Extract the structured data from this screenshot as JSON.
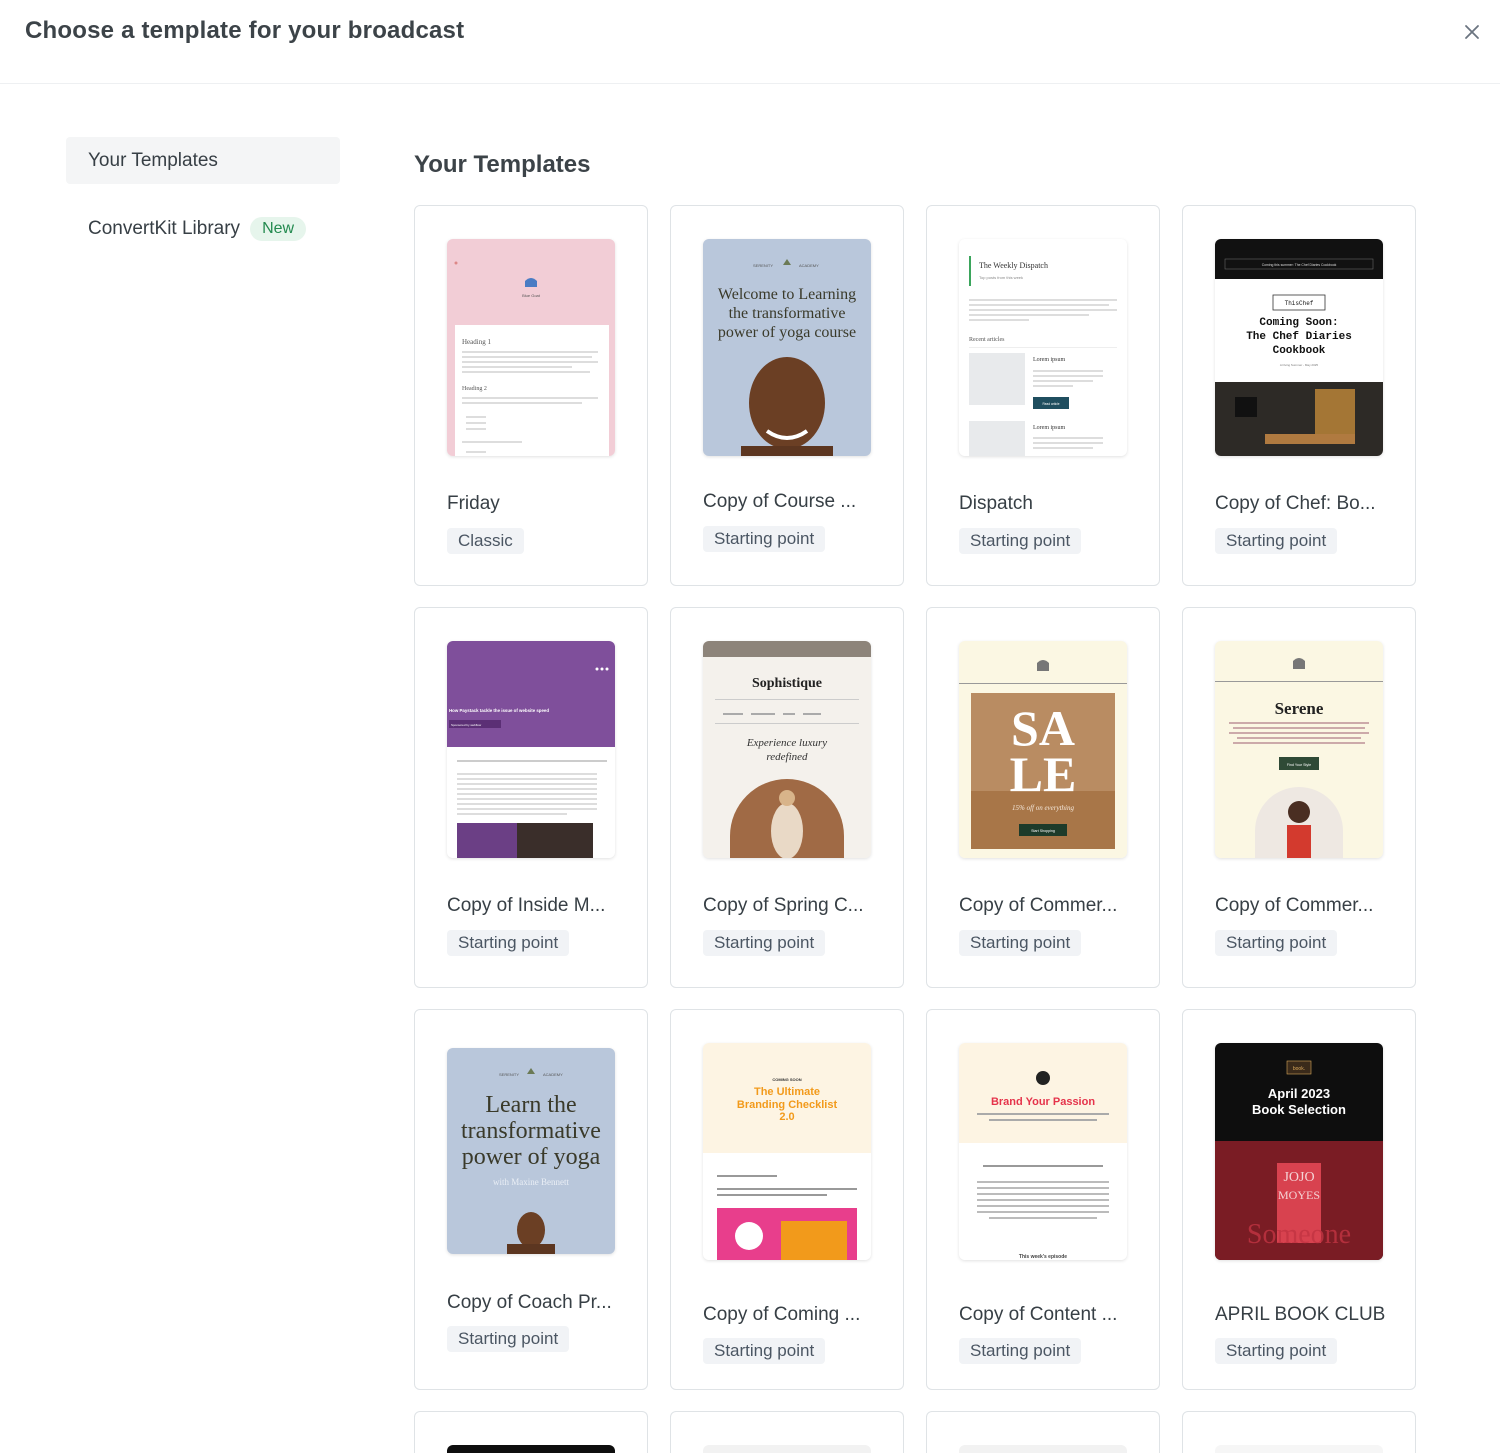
{
  "modal": {
    "title": "Choose a template for your broadcast",
    "close_icon": "close-icon"
  },
  "sidebar": {
    "items": [
      {
        "label": "Your Templates",
        "active": true
      },
      {
        "label": "ConvertKit Library",
        "badge": "New"
      }
    ]
  },
  "main": {
    "section_title": "Your Templates",
    "templates": [
      {
        "name": "Friday",
        "tag": "Classic"
      },
      {
        "name": "Copy of Course ...",
        "tag": "Starting point"
      },
      {
        "name": "Dispatch",
        "tag": "Starting point"
      },
      {
        "name": "Copy of Chef: Bo...",
        "tag": "Starting point"
      },
      {
        "name": "Copy of Inside M...",
        "tag": "Starting point"
      },
      {
        "name": "Copy of Spring C...",
        "tag": "Starting point"
      },
      {
        "name": "Copy of Commer...",
        "tag": "Starting point"
      },
      {
        "name": "Copy of Commer...",
        "tag": "Starting point"
      },
      {
        "name": "Copy of Coach Pr...",
        "tag": "Starting point"
      },
      {
        "name": "Copy of Coming ...",
        "tag": "Starting point"
      },
      {
        "name": "Copy of Content ...",
        "tag": "Starting point"
      },
      {
        "name": "APRIL BOOK CLUB",
        "tag": "Starting point"
      }
    ]
  },
  "thumbnails": {
    "friday": {
      "heading1": "Heading 1",
      "heading2": "Heading 2",
      "logo": "Blue Goat"
    },
    "course": {
      "brand_left": "SERENITY",
      "brand_right": "ACADEMY",
      "headline": [
        "Welcome to Learning",
        "the transformative",
        "power of yoga course"
      ]
    },
    "dispatch": {
      "title": "The Weekly Dispatch",
      "subtitle": "Top posts from this week",
      "section": "Recent articles",
      "article1": "Lorem ipsum",
      "article2": "Lorem ipsum",
      "button": "Read article"
    },
    "chef": {
      "banner": "Coming this summer: The Chef Diaries Cookbook",
      "brand": "ThisChef",
      "headline": [
        "Coming Soon:",
        "The Chef Diaries",
        "Cookbook"
      ],
      "date": "Arriving Summer - May 2025"
    },
    "inside": {
      "headline": "How Paystack tackle the issue of website speed",
      "sponsor": "Sponsored by webflow"
    },
    "spring": {
      "brand": "Sophistique",
      "tagline": [
        "Experience luxury",
        "redefined"
      ]
    },
    "sale": {
      "headline": [
        "SA",
        "LE"
      ],
      "sub": "15% off on everything",
      "button": "Start Shopping"
    },
    "serene": {
      "brand": "Serene",
      "button": "Find Your Style"
    },
    "coach": {
      "brand_left": "SERENITY",
      "brand_right": "ACADEMY",
      "headline": [
        "Learn the",
        "transformative",
        "power of yoga"
      ],
      "sub": "with Maxine Bennett"
    },
    "coming": {
      "eyebrow": "COMING SOON",
      "headline": [
        "The Ultimate",
        "Branding Checklist",
        "2.0"
      ]
    },
    "content": {
      "headline": "Brand Your Passion",
      "footer": "This week's episode"
    },
    "book": {
      "badge": "book.",
      "headline": [
        "April 2023",
        "Book Selection"
      ],
      "bg": [
        "JOJO",
        "MOYES",
        "Someone"
      ]
    }
  },
  "colors": {
    "accent_green": "#238a4f",
    "tag_bg": "#f1f3f6",
    "border": "#dfe3e6"
  }
}
